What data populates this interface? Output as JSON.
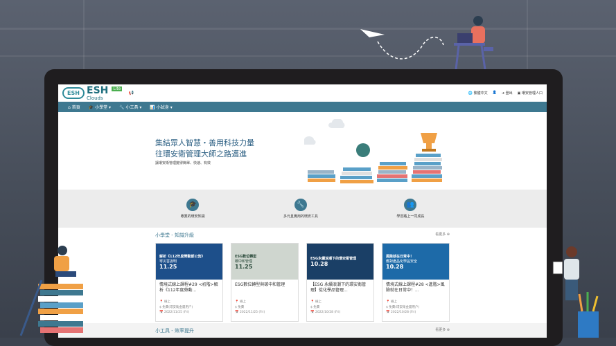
{
  "logo": {
    "mark": "ESH",
    "name": "ESH",
    "sub": "Clouds",
    "badge": "Lite"
  },
  "topbar": {
    "lang": "繁體中文",
    "logout": "登出",
    "account": "環安管理人口"
  },
  "nav": [
    {
      "label": "首頁",
      "icon": "home-icon"
    },
    {
      "label": "小學堂",
      "icon": "graduation-cap-icon"
    },
    {
      "label": "小工具",
      "icon": "wrench-icon"
    },
    {
      "label": "小試身",
      "icon": "chart-icon"
    }
  ],
  "hero": {
    "title1": "集結眾人智慧・善用科技力量",
    "title2": "往環安衛管理大師之路邁進",
    "subtitle": "讓環安衛管理變得簡單、快速、有效"
  },
  "features": [
    {
      "label": "專業的環安知識",
      "icon": "graduation-cap-icon",
      "glyph": "🎓"
    },
    {
      "label": "多元且實用的環安工具",
      "icon": "wrench-icon",
      "glyph": "🔧"
    },
    {
      "label": "學習路上一同成長",
      "icon": "group-icon",
      "glyph": "👥"
    }
  ],
  "section1": {
    "title": "小學堂 - 知識升級",
    "more": "看更多 ⊕"
  },
  "cards": [
    {
      "bg": "#1d4f8a",
      "img_t1": "解析《112年度勞動部公告》",
      "img_t2": "零災害說明",
      "date": "11.25",
      "title": "情境式線上課程#29 <初階>解析《112年度勞動...",
      "place": "線上",
      "fee": "免費(環安衛金屬用户)",
      "when": "2022/11/25 (Fri)"
    },
    {
      "bg": "#cfd6cf",
      "img_t1": "ESG數位轉型",
      "img_t2": "碳中和管理",
      "date": "11.25",
      "title": "ESG數位轉型與碳中和管理",
      "place": "線上",
      "fee": "免費",
      "when": "2022/11/25 (Fri)"
    },
    {
      "bg": "#1a3f66",
      "img_t1": "ESG永續浪潮下的環安衛管理",
      "img_t2": "",
      "date": "10.28",
      "title": "【ESG 永續浪潮下的環安衛管理】從化學品管理...",
      "place": "線上",
      "fee": "免費",
      "when": "2022/10/28 (Fri)"
    },
    {
      "bg": "#1d6aa8",
      "img_t1": "風險就在日常中！",
      "img_t2": "應對產品化學品安全",
      "date": "10.28",
      "title": "情境式線上課程#28 <進階>風險就在日常中！...",
      "place": "線上",
      "fee": "免費(環安衛金屬用户)",
      "when": "2022/10/28 (Fri)"
    }
  ],
  "section2": {
    "title": "小工具 - 效率提升",
    "more": "看更多 ⊕"
  }
}
